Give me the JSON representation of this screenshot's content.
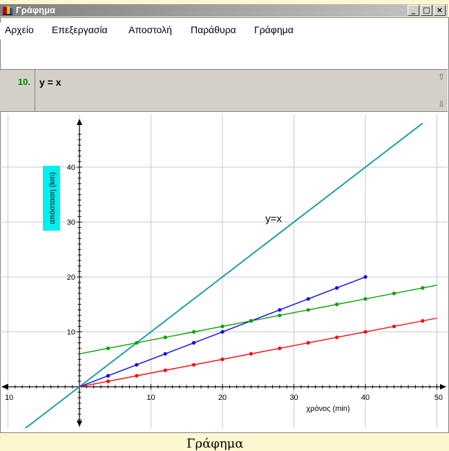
{
  "window": {
    "title": "Γράφημα"
  },
  "controls": {
    "minimize": "_",
    "maximize": "□",
    "close": "×"
  },
  "menu": [
    "Αρχείο",
    "Επεξεργασία",
    "Αποστολή",
    "Παράθυρα",
    "Γράφημα"
  ],
  "expression": {
    "number": "10.",
    "text": "y = x"
  },
  "chart_data": {
    "type": "line",
    "xlabel": "χρόνος (min)",
    "ylabel": "απόσταση (km)",
    "xlim": [
      -10,
      50
    ],
    "ylim": [
      -7,
      48
    ],
    "x_tick_labels": [
      "10",
      "10",
      "20",
      "30",
      "40",
      "50"
    ],
    "x_tick_values": [
      -10,
      10,
      20,
      30,
      40,
      50
    ],
    "y_tick_labels": [
      "10",
      "20",
      "30",
      "40"
    ],
    "y_tick_values": [
      10,
      20,
      30,
      40
    ],
    "grid": true,
    "annotation": {
      "text": "y=x",
      "x": 26,
      "y": 30
    },
    "series": [
      {
        "color": "#1a9ea4",
        "line": [
          [
            -8,
            -8
          ],
          [
            48,
            48
          ]
        ],
        "points": []
      },
      {
        "color": "#0000ff",
        "line": [
          [
            0,
            0
          ],
          [
            40,
            20
          ]
        ],
        "points": [
          [
            4,
            2
          ],
          [
            8,
            4
          ],
          [
            12,
            6
          ],
          [
            16,
            8
          ],
          [
            20,
            10
          ],
          [
            24,
            12
          ],
          [
            28,
            14
          ],
          [
            32,
            16
          ],
          [
            36,
            18
          ],
          [
            40,
            20
          ]
        ]
      },
      {
        "color": "#00a000",
        "line": [
          [
            0,
            6
          ],
          [
            50,
            18.5
          ]
        ],
        "points": [
          [
            4,
            7
          ],
          [
            8,
            8
          ],
          [
            12,
            9
          ],
          [
            16,
            10
          ],
          [
            20,
            11
          ],
          [
            24,
            12
          ],
          [
            28,
            13
          ],
          [
            32,
            14
          ],
          [
            36,
            15
          ],
          [
            40,
            16
          ],
          [
            44,
            17
          ],
          [
            48,
            18
          ]
        ]
      },
      {
        "color": "#ff0000",
        "line": [
          [
            0,
            0
          ],
          [
            50,
            12.5
          ]
        ],
        "points": [
          [
            4,
            1
          ],
          [
            8,
            2
          ],
          [
            12,
            3
          ],
          [
            16,
            4
          ],
          [
            20,
            5
          ],
          [
            24,
            6
          ],
          [
            28,
            7
          ],
          [
            32,
            8
          ],
          [
            36,
            9
          ],
          [
            40,
            10
          ],
          [
            44,
            11
          ],
          [
            48,
            12
          ]
        ]
      }
    ]
  },
  "footer": {
    "text": "Γράφημα"
  }
}
